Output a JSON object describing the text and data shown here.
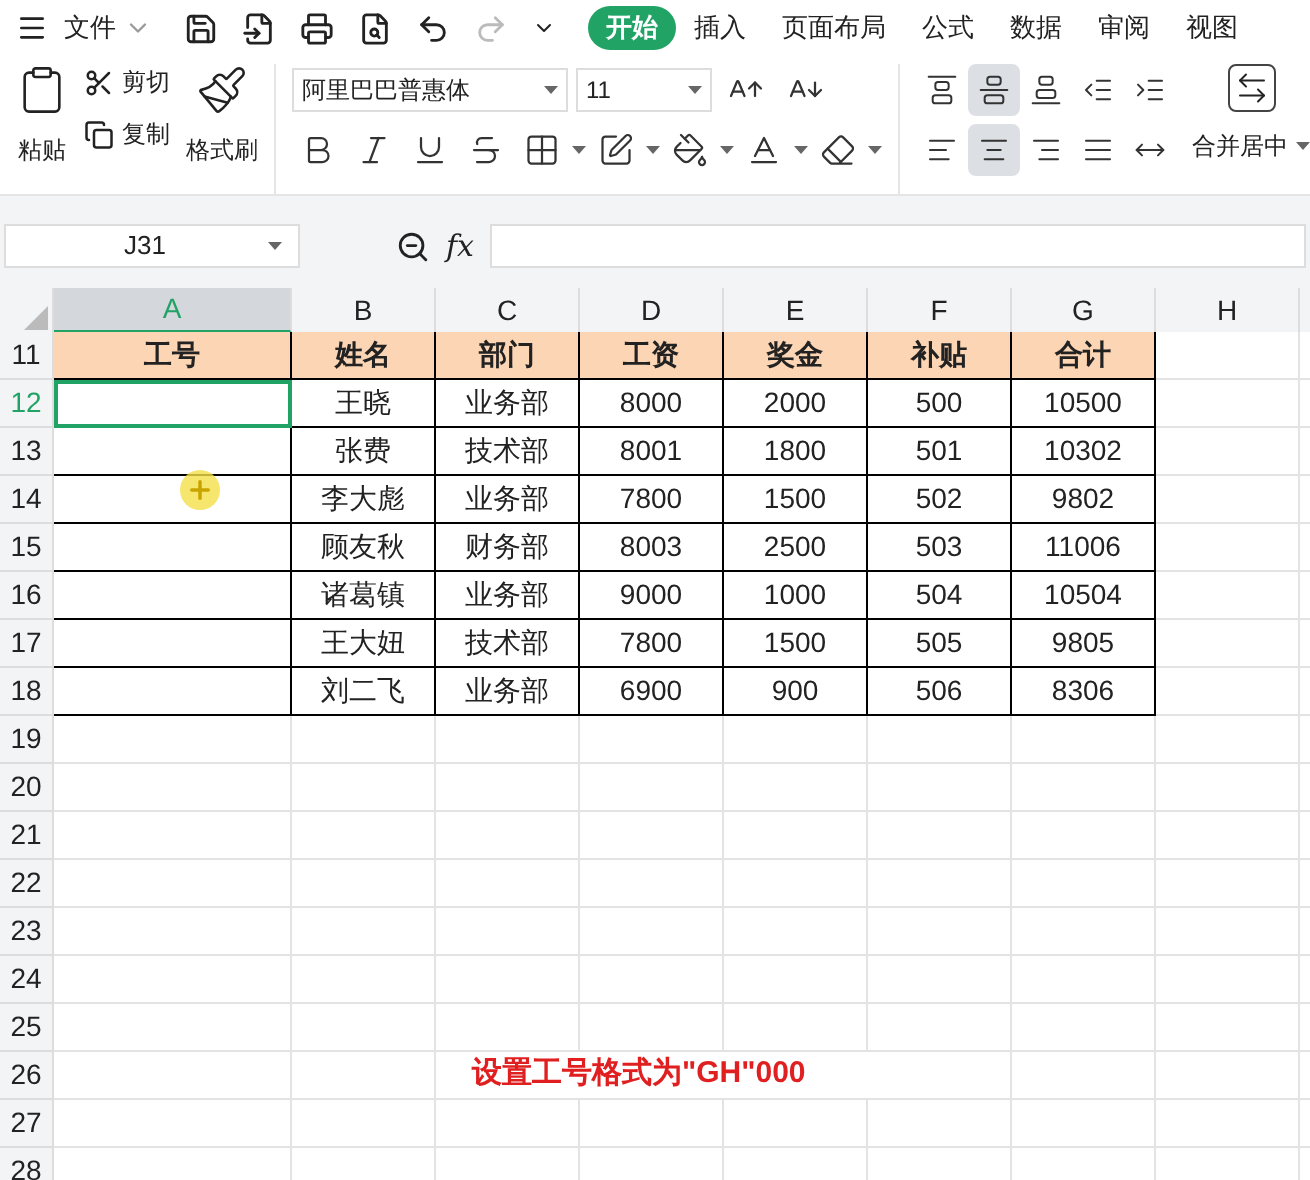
{
  "menu": {
    "label": "文件"
  },
  "tabs": [
    {
      "label": "开始",
      "selected": true
    },
    {
      "label": "插入",
      "selected": false
    },
    {
      "label": "页面布局",
      "selected": false
    },
    {
      "label": "公式",
      "selected": false
    },
    {
      "label": "数据",
      "selected": false
    },
    {
      "label": "审阅",
      "selected": false
    },
    {
      "label": "视图",
      "selected": false
    }
  ],
  "ribbon": {
    "paste": "粘贴",
    "cut": "剪切",
    "copy": "复制",
    "format_painter": "格式刷",
    "font": "阿里巴巴普惠体",
    "size": "11",
    "merge": "合并居中",
    "vertical_align": [
      {
        "kind": "top",
        "selected": false
      },
      {
        "kind": "middle",
        "selected": true
      },
      {
        "kind": "bottom",
        "selected": false
      }
    ],
    "horizontal_align": [
      {
        "kind": "left",
        "selected": false
      },
      {
        "kind": "center",
        "selected": true
      },
      {
        "kind": "right",
        "selected": false
      }
    ]
  },
  "formula_bar": {
    "name_box": "J31",
    "fx": "fx"
  },
  "columns": [
    {
      "label": "A",
      "selected": true
    },
    {
      "label": "B",
      "selected": false
    },
    {
      "label": "C",
      "selected": false
    },
    {
      "label": "D",
      "selected": false
    },
    {
      "label": "E",
      "selected": false
    },
    {
      "label": "F",
      "selected": false
    },
    {
      "label": "G",
      "selected": false
    },
    {
      "label": "H",
      "selected": false
    }
  ],
  "rows": [
    {
      "number": "11",
      "kind": "header",
      "selected": false,
      "cells": [
        "工号",
        "姓名",
        "部门",
        "工资",
        "奖金",
        "补贴",
        "合计"
      ]
    },
    {
      "number": "12",
      "kind": "record",
      "selected": true,
      "cells": [
        "王晓",
        "业务部",
        "8000",
        "2000",
        "500",
        "10500"
      ]
    },
    {
      "number": "13",
      "kind": "record",
      "selected": false,
      "cells": [
        "张费",
        "技术部",
        "8001",
        "1800",
        "501",
        "10302"
      ]
    },
    {
      "number": "14",
      "kind": "record",
      "selected": false,
      "cells": [
        "李大彪",
        "业务部",
        "7800",
        "1500",
        "502",
        "9802"
      ]
    },
    {
      "number": "15",
      "kind": "record",
      "selected": false,
      "cells": [
        "顾友秋",
        "财务部",
        "8003",
        "2500",
        "503",
        "11006"
      ]
    },
    {
      "number": "16",
      "kind": "record",
      "selected": false,
      "cells": [
        "诸葛镇",
        "业务部",
        "9000",
        "1000",
        "504",
        "10504"
      ]
    },
    {
      "number": "17",
      "kind": "record",
      "selected": false,
      "cells": [
        "王大妞",
        "技术部",
        "7800",
        "1500",
        "505",
        "9805"
      ]
    },
    {
      "number": "18",
      "kind": "record",
      "selected": false,
      "cells": [
        "刘二飞",
        "业务部",
        "6900",
        "900",
        "506",
        "8306"
      ]
    },
    {
      "number": "19",
      "kind": "blank",
      "selected": false
    },
    {
      "number": "20",
      "kind": "blank",
      "selected": false
    },
    {
      "number": "21",
      "kind": "blank",
      "selected": false
    },
    {
      "number": "22",
      "kind": "blank",
      "selected": false
    },
    {
      "number": "23",
      "kind": "blank",
      "selected": false
    },
    {
      "number": "24",
      "kind": "blank",
      "selected": false
    },
    {
      "number": "25",
      "kind": "blank",
      "selected": false
    },
    {
      "number": "26",
      "kind": "blank",
      "selected": false,
      "note": "设置工号格式为\"GH\"000"
    },
    {
      "number": "27",
      "kind": "blank",
      "selected": false
    },
    {
      "number": "28",
      "kind": "blank",
      "selected": false
    }
  ]
}
